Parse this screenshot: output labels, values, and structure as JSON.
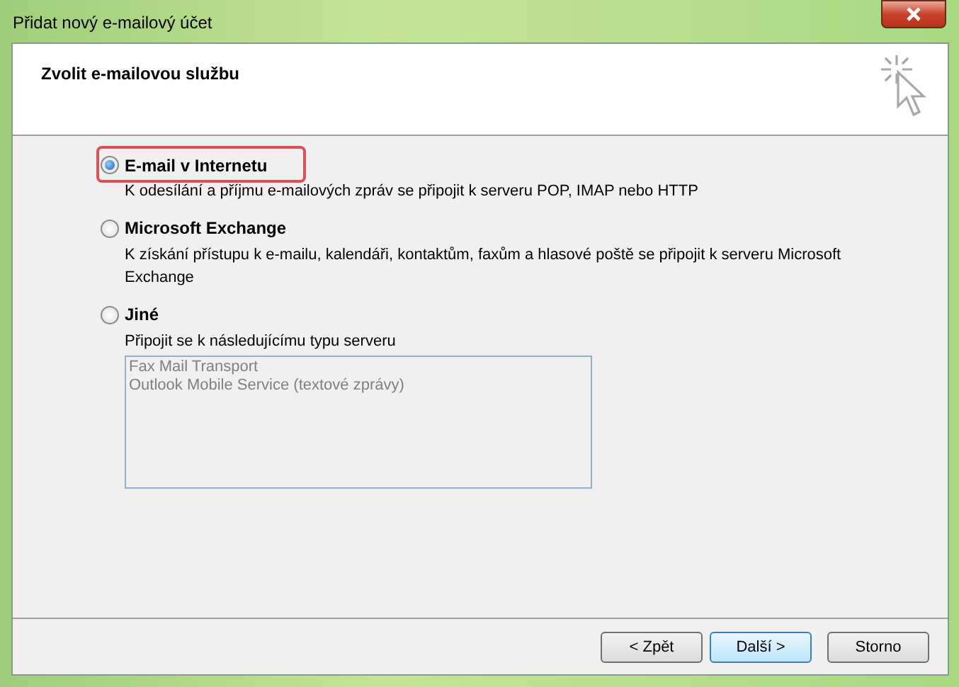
{
  "window": {
    "title": "Přidat nový e-mailový účet"
  },
  "header": {
    "title": "Zvolit e-mailovou službu"
  },
  "options": [
    {
      "label": "E-mail v Internetu",
      "description": "K odesílání a příjmu e-mailových zpráv se připojit k serveru POP, IMAP nebo HTTP",
      "selected": true,
      "highlighted": true
    },
    {
      "label": "Microsoft Exchange",
      "description": "K získání přístupu k e-mailu, kalendáři, kontaktům, faxům a hlasové poště se připojit k serveru Microsoft Exchange",
      "selected": false,
      "highlighted": false
    },
    {
      "label": "Jiné",
      "description": "Připojit se k následujícímu typu serveru",
      "selected": false,
      "highlighted": false
    }
  ],
  "server_list": {
    "disabled": true,
    "items": [
      "Fax Mail Transport",
      "Outlook Mobile Service (textové zprávy)"
    ]
  },
  "buttons": [
    {
      "label": "< Zpět",
      "default": false
    },
    {
      "label": "Další >",
      "default": true
    },
    {
      "label": "Storno",
      "default": false
    }
  ]
}
